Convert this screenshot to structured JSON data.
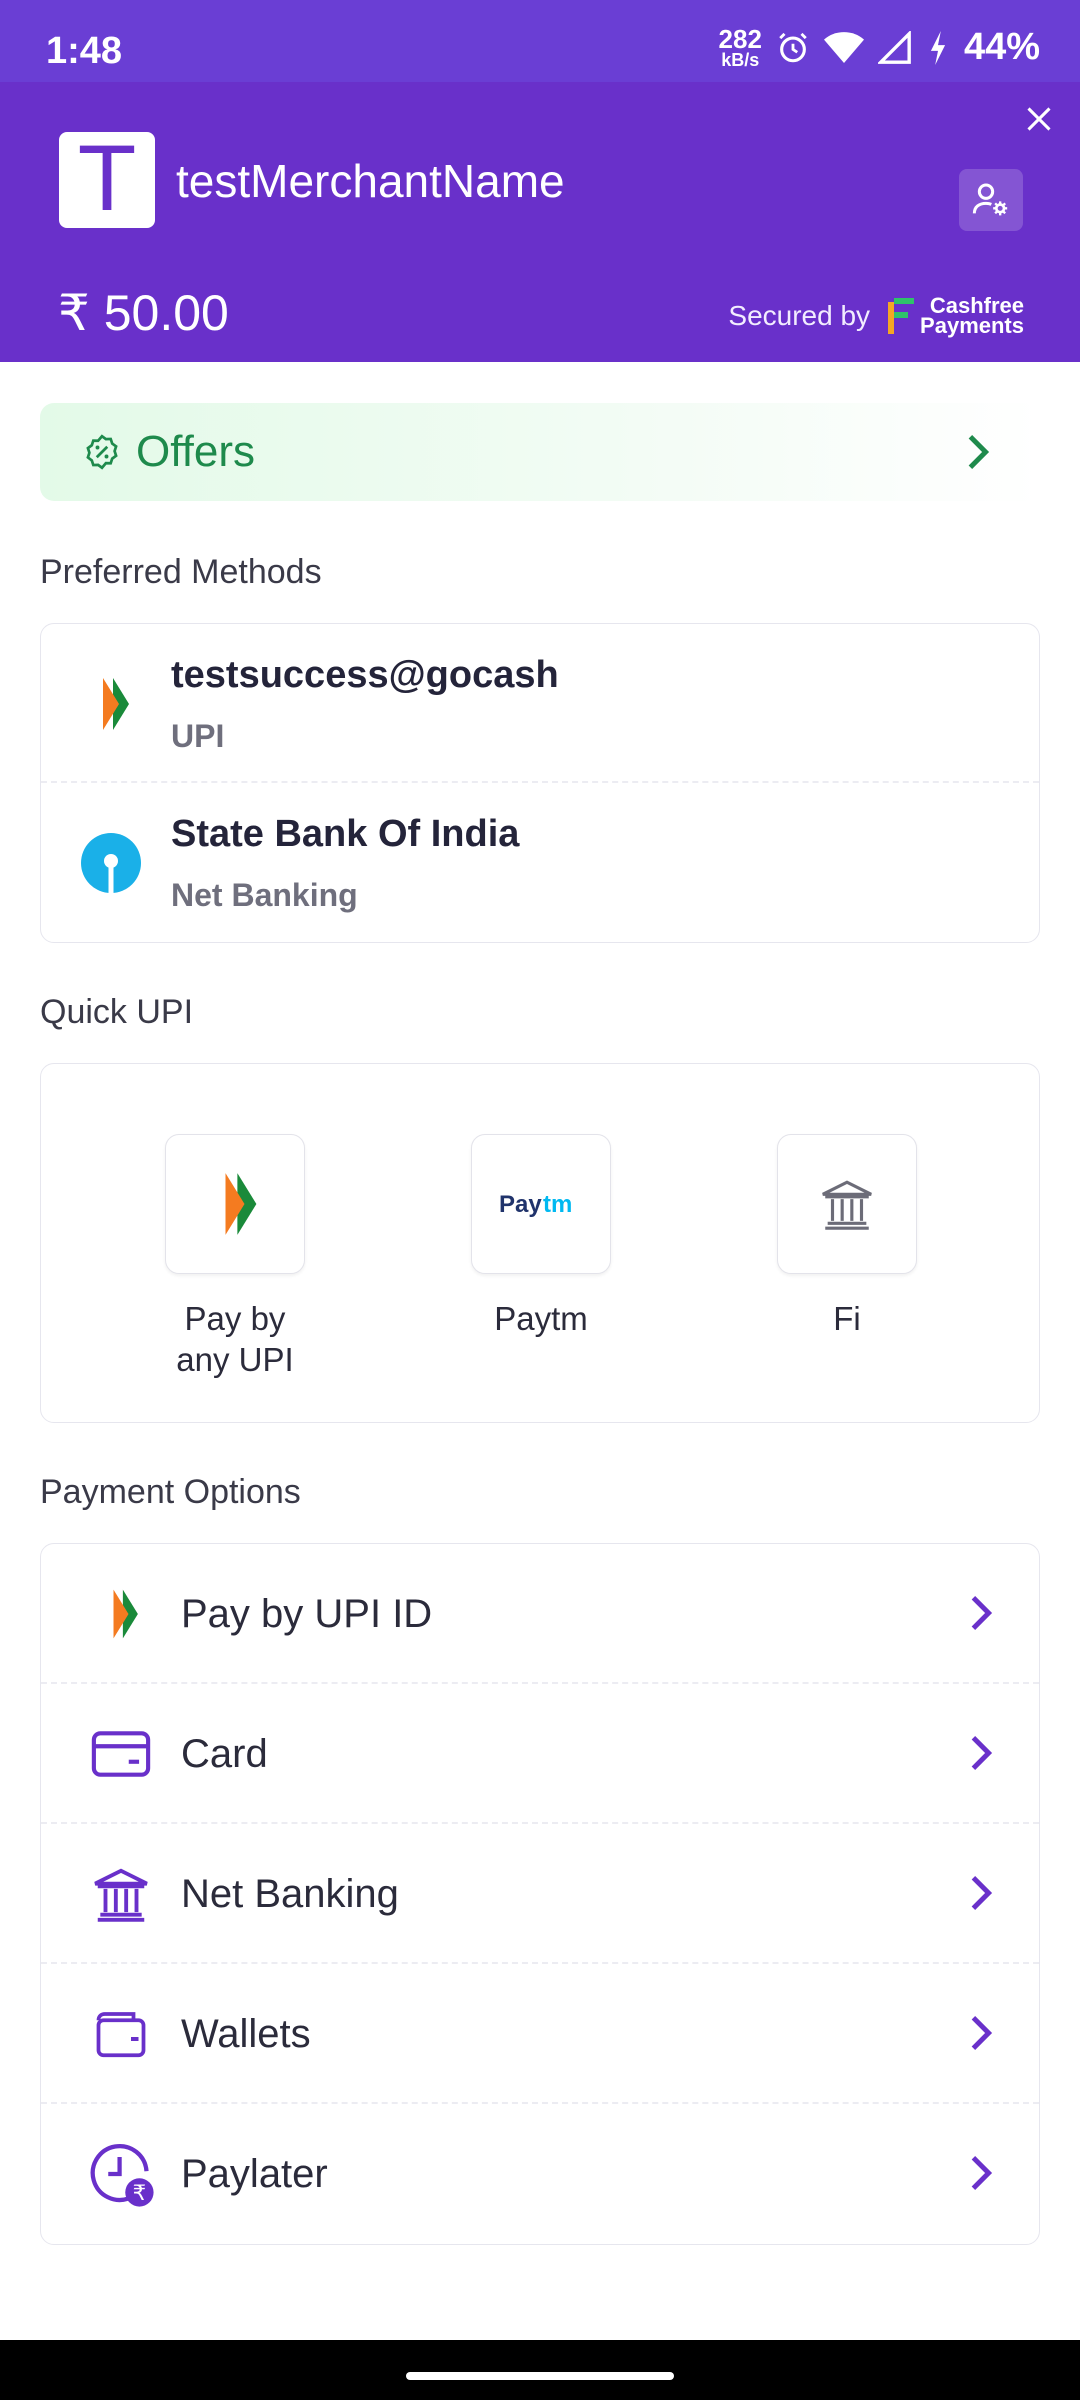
{
  "status_bar": {
    "time": "1:48",
    "speed_value": "282",
    "speed_unit": "kB/s",
    "battery": "44%"
  },
  "header": {
    "merchant_initial": "T",
    "merchant_name": "testMerchantName",
    "amount": "₹ 50.00",
    "secured_by": "Secured by",
    "brand_line1": "Cashfree",
    "brand_line2": "Payments",
    "brand_color": "#6930ca"
  },
  "offers": {
    "label": "Offers",
    "accent": "#1e8a4c"
  },
  "preferred": {
    "title": "Preferred Methods",
    "items": [
      {
        "title": "testsuccess@gocash",
        "subtitle": "UPI",
        "icon": "upi-icon"
      },
      {
        "title": "State Bank Of India",
        "subtitle": "Net Banking",
        "icon": "sbi-icon"
      }
    ]
  },
  "quick_upi": {
    "title": "Quick UPI",
    "apps": [
      {
        "label": "Pay by\nany UPI",
        "icon": "upi-icon"
      },
      {
        "label": "Paytm",
        "icon": "paytm-icon"
      },
      {
        "label": "Fi",
        "icon": "bank-icon"
      }
    ]
  },
  "payment_options": {
    "title": "Payment Options",
    "items": [
      {
        "label": "Pay by UPI ID",
        "icon": "upi-icon"
      },
      {
        "label": "Card",
        "icon": "card-icon"
      },
      {
        "label": "Net Banking",
        "icon": "bank-icon"
      },
      {
        "label": "Wallets",
        "icon": "wallet-icon"
      },
      {
        "label": "Paylater",
        "icon": "paylater-icon"
      }
    ]
  }
}
